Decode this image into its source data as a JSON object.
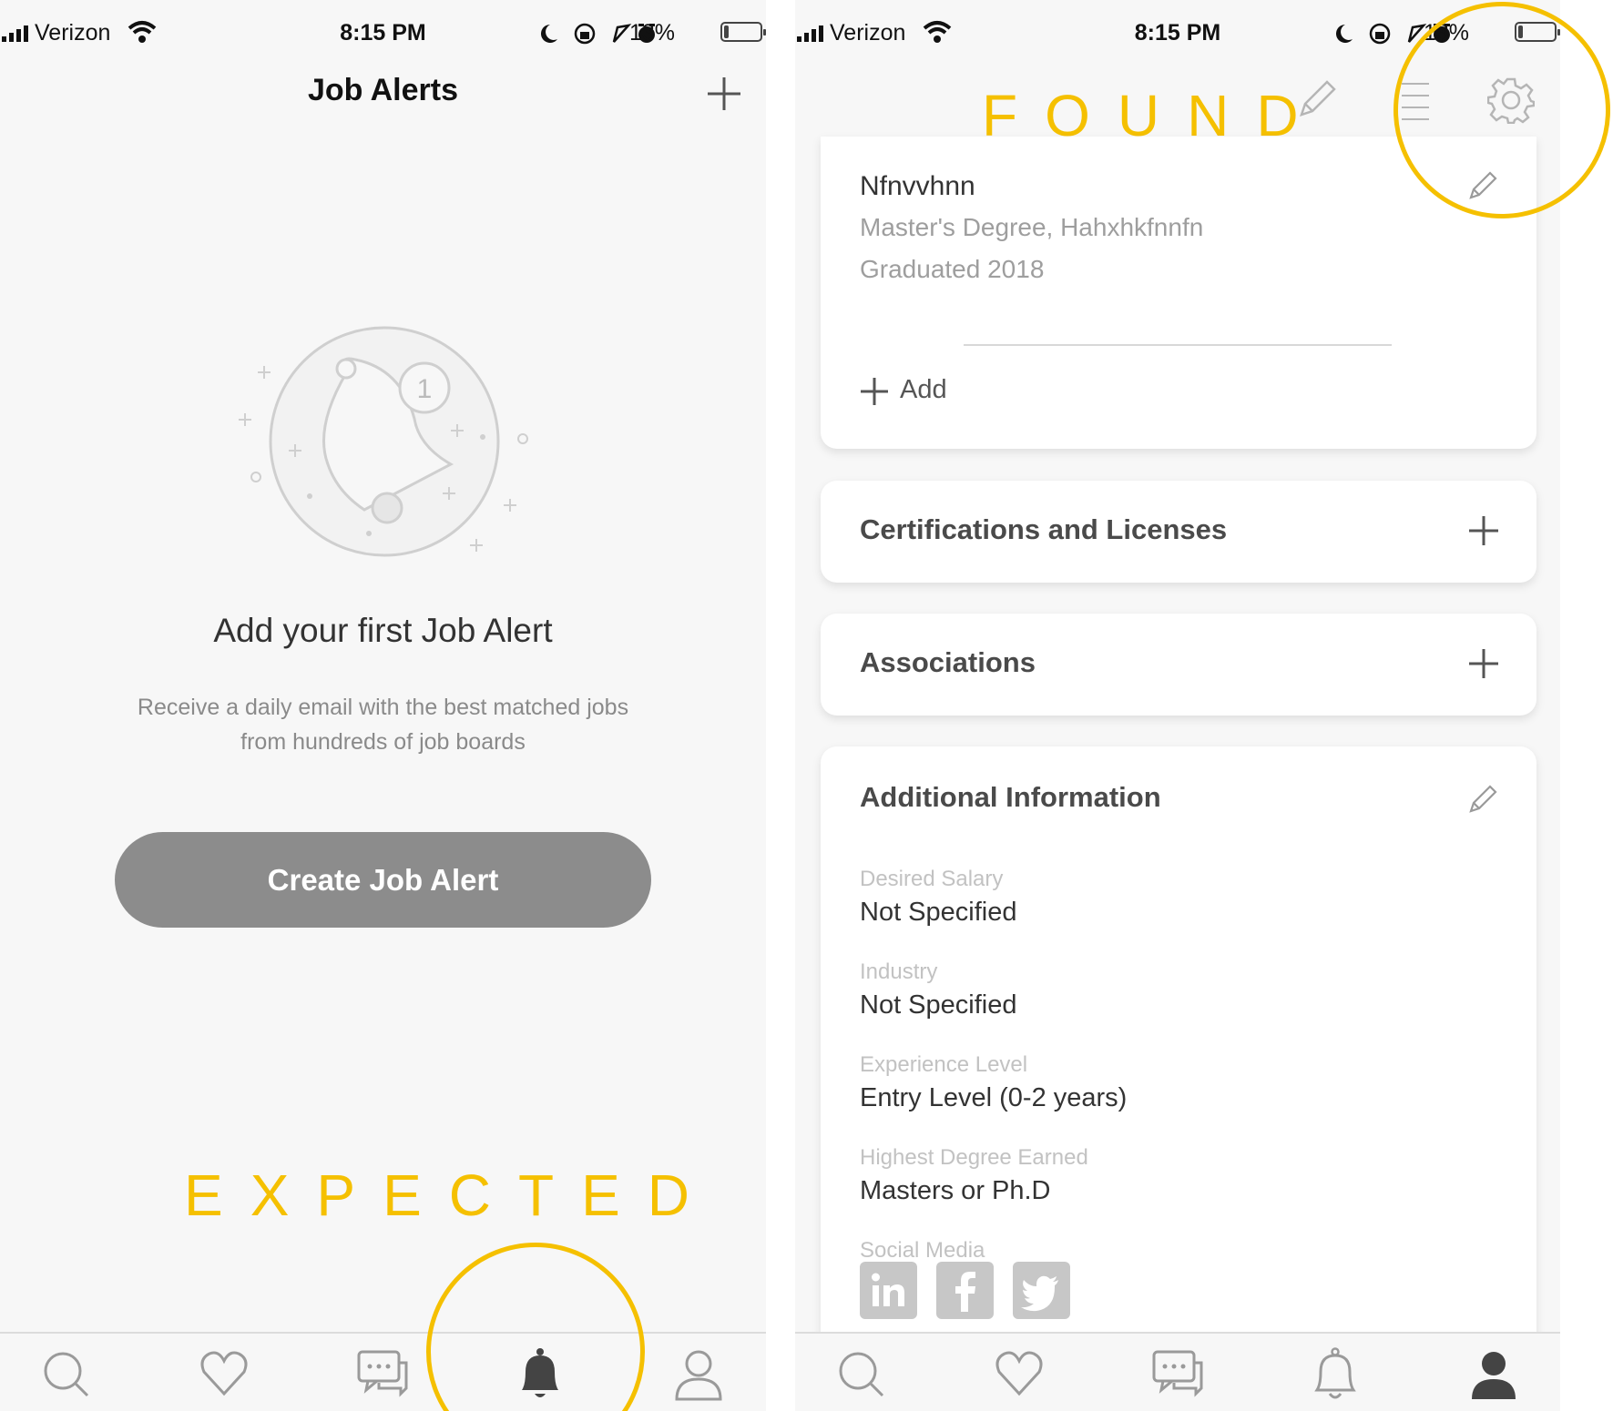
{
  "status_bar": {
    "carrier": "Verizon",
    "time": "8:15 PM",
    "battery": "13%"
  },
  "left_screen": {
    "title": "Job Alerts",
    "empty_state": {
      "badge_count": "1",
      "heading": "Add your first Job Alert",
      "description_line1": "Receive a daily email with the best matched jobs",
      "description_line2": "from hundreds of job boards"
    },
    "create_button": "Create Job Alert",
    "annotation": "EXPECTED",
    "active_tab": "alerts"
  },
  "right_screen": {
    "annotation": "FOUND",
    "education": {
      "name": "Nfnvvhnn",
      "degree": "Master's Degree, Hahxhkfnnfn",
      "graduated": "Graduated 2018",
      "add_label": "Add"
    },
    "sections": [
      {
        "title": "Certifications and Licenses"
      },
      {
        "title": "Associations"
      }
    ],
    "additional_info": {
      "title": "Additional Information",
      "fields": [
        {
          "label": "Desired Salary",
          "value": "Not Specified"
        },
        {
          "label": "Industry",
          "value": "Not Specified"
        },
        {
          "label": "Experience Level",
          "value": "Entry Level (0-2 years)"
        },
        {
          "label": "Highest Degree Earned",
          "value": "Masters or Ph.D"
        }
      ],
      "social_label": "Social Media",
      "social": [
        "linkedin-icon",
        "facebook-icon",
        "twitter-icon"
      ]
    },
    "active_tab": "profile"
  },
  "tabs": [
    "search-icon",
    "heart-icon",
    "messages-icon",
    "bell-icon",
    "profile-icon"
  ],
  "colors": {
    "annotation": "#f5c000",
    "button": "#8c8c8c",
    "background": "#f7f7f7",
    "active_icon": "#444444",
    "inactive_icon": "#9a9a9a"
  }
}
